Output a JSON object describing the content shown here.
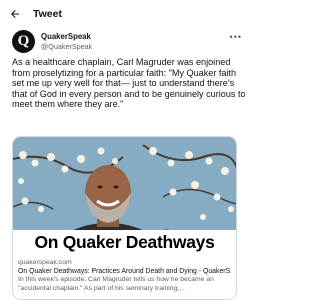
{
  "header": {
    "title": "Tweet"
  },
  "author": {
    "avatar_letter": "Q",
    "display_name": "QuakerSpeak",
    "handle": "@QuakerSpeak"
  },
  "tweet": {
    "text": "As a healthcare chaplain, Carl Magruder was enjoined from proselytizing for a particular faith: \"My Quaker faith set me up very well for that— just to understand there's that of God in every person and to be genuinely curious to meet them where they are.\""
  },
  "card": {
    "banner": "On Quaker Deathways",
    "domain": "quakerspeak.com",
    "title": "On Quaker Deathways: Practices Around Death and Dying - QuakerS...",
    "description": "In this week's episode, Carl Magruder tells us how he became an \"accidental chaplain.\" As part of his seminary training,..."
  },
  "icons": {
    "back": "arrow-left-icon",
    "more": "more-horizontal-icon"
  },
  "colors": {
    "secondary_text": "#536471",
    "border": "#cfd9de",
    "sky": "#86acc3",
    "blossom": "#f4f1e6"
  }
}
